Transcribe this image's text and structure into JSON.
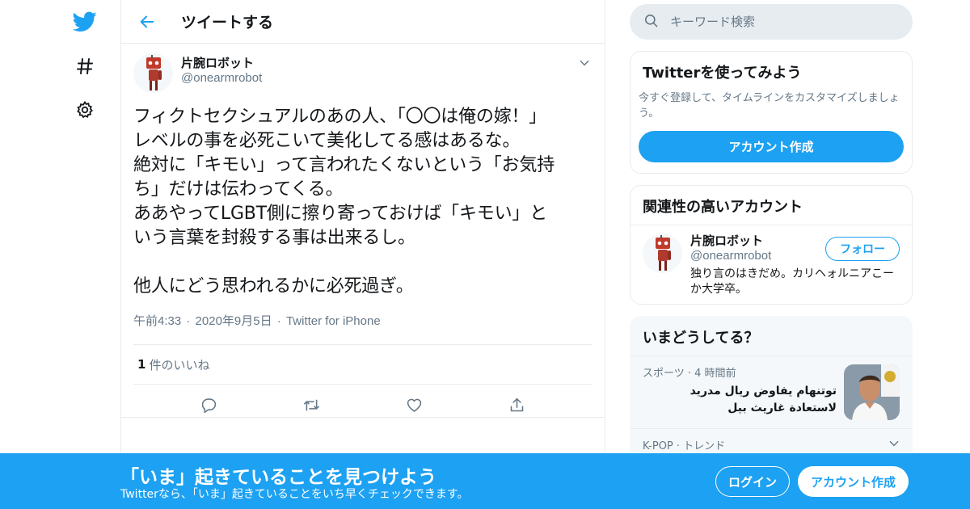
{
  "colors": {
    "accent": "#1da1f2",
    "secondary_text": "#657786",
    "border": "#e6ecf0",
    "banner_bg": "#1da1f2"
  },
  "nav": {
    "icons": [
      "twitter-logo-icon",
      "hashtag-icon",
      "gear-icon"
    ]
  },
  "header": {
    "title": "ツイートする",
    "back_icon": "arrow-left-icon"
  },
  "tweet": {
    "display_name": "片腕ロボット",
    "handle": "@onearmrobot",
    "text": "フィクトセクシュアルのあの人、「〇〇は俺の嫁！」\nレベルの事を必死こいて美化してる感はあるな。\n絶対に「キモい」って言われたくないという「お気持\nち」だけは伝わってくる。\nああやってLGBT側に擦り寄っておけば「キモい」と\nいう言葉を封殺する事は出来るし。\n\n他人にどう思われるかに必死過ぎ。",
    "time": "午前4:33",
    "date": "2020年9月5日",
    "source": "Twitter for iPhone",
    "separator": "·",
    "like_count": "1",
    "like_label": "件のいいね",
    "actions": [
      "reply-icon",
      "retweet-icon",
      "like-icon",
      "share-icon"
    ]
  },
  "sidebar": {
    "search": {
      "placeholder": "キーワード検索"
    },
    "signup_card": {
      "title": "Twitterを使ってみよう",
      "description": "今すぐ登録して、タイムラインをカスタマイズしましょう。",
      "button": "アカウント作成"
    },
    "related": {
      "title": "関連性の高いアカウント",
      "name": "片腕ロボット",
      "handle": "@onearmrobot",
      "bio": "独り言のはきだめ。カリヘォルニアこーか大学卒。",
      "follow_label": "フォロー"
    },
    "trends": {
      "title": "いまどうしてる？",
      "items": [
        {
          "meta": "スポーツ · 4 時間前",
          "text": "توتنهام يفاوض ريال مدريد لاستعادة غاريث بيل"
        },
        {
          "meta": "K-POP · トレンド"
        }
      ]
    }
  },
  "banner": {
    "title": "「いま」起きていることを見つけよう",
    "subtitle": "Twitterなら、「いま」起きていることをいち早くチェックできます。",
    "login": "ログイン",
    "signup": "アカウント作成"
  }
}
